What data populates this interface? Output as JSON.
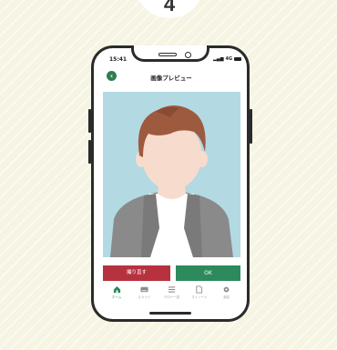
{
  "step_number": "4",
  "status_bar": {
    "time": "15:41",
    "network": "4G"
  },
  "header": {
    "title": "画像プレビュー",
    "back_icon": "chevron-left-icon"
  },
  "photo": {
    "background_color": "#b3d9e3",
    "hair_color": "#9e5a3f",
    "skin_color": "#f7dbcd",
    "jacket_color": "#8a8a8a"
  },
  "actions": {
    "retake_label": "撮り直す",
    "ok_label": "OK"
  },
  "colors": {
    "accent_green": "#2c8a5d",
    "accent_red": "#b7323f",
    "backdrop": "#f6f4e2"
  },
  "tabbar": {
    "items": [
      {
        "label": "ホーム",
        "icon": "home-icon",
        "active": true
      },
      {
        "label": "スライド",
        "icon": "keyboard-icon",
        "active": false
      },
      {
        "label": "クロー一覧",
        "icon": "list-icon",
        "active": false
      },
      {
        "label": "マイノート",
        "icon": "document-icon",
        "active": false
      },
      {
        "label": "設定",
        "icon": "gear-icon",
        "active": false
      }
    ]
  }
}
